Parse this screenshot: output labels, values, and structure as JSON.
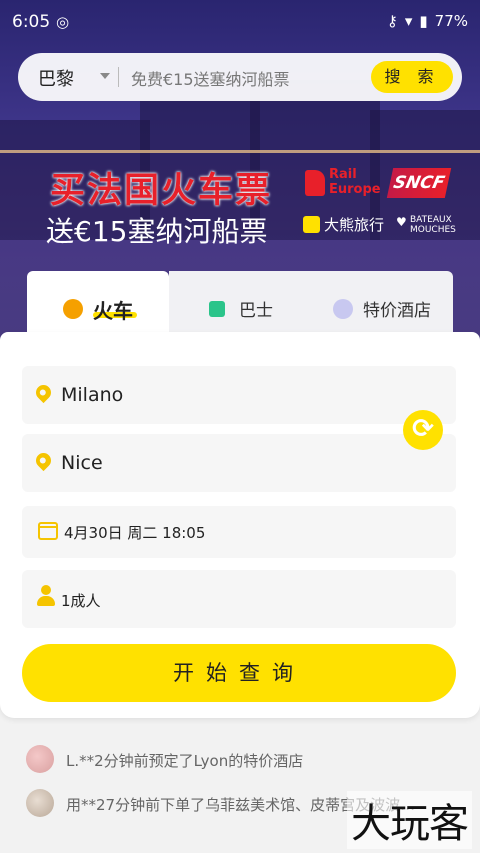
{
  "status_bar": {
    "time": "6:05",
    "indicator": "◎",
    "key": "⚷",
    "wifi": "▾",
    "battery_icon": "▮",
    "battery": "77%"
  },
  "search": {
    "city": "巴黎",
    "placeholder": "免费€15送塞纳河船票",
    "button": "搜 索"
  },
  "banner": {
    "title_red_1": "买法国",
    "title_white": "火车票",
    "subtitle": "送€15塞纳河船票",
    "rail_europe_1": "Rail",
    "rail_europe_2": "Europe",
    "sncf": "SNCF",
    "daxiong": "大熊旅行",
    "bateaux_1": "BATEAUX",
    "bateaux_2": "MOUCHES"
  },
  "tabs": [
    {
      "label": "火车",
      "active": true
    },
    {
      "label": "巴士",
      "active": false
    },
    {
      "label": "特价酒店",
      "active": false
    }
  ],
  "form": {
    "from": "Milano",
    "to": "Nice",
    "date": "4月30日 周二 18:05",
    "passengers": "1成人",
    "swap_icon": "⟳",
    "submit": "开始查询"
  },
  "feed": [
    {
      "text": "L.**2分钟前预定了Lyon的特价酒店"
    },
    {
      "text": "用**27分钟前下单了乌菲兹美术馆、皮蒂宫及波波…"
    }
  ],
  "watermark": "大玩客",
  "colors": {
    "accent": "#ffe100",
    "icon_yellow": "#f5c400",
    "brand_red": "#e8202a"
  }
}
